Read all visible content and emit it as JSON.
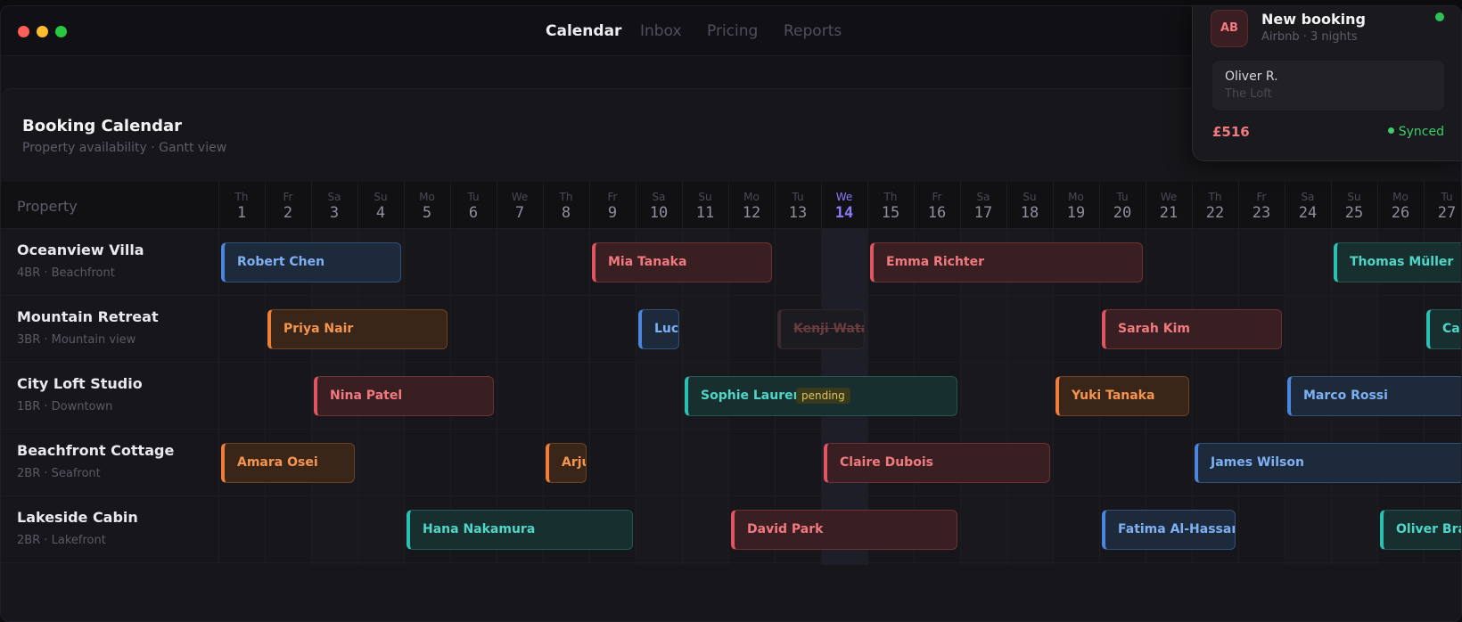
{
  "nav": {
    "tabs": [
      {
        "label": "Calendar",
        "active": true
      },
      {
        "label": "Inbox",
        "active": false
      },
      {
        "label": "Pricing",
        "active": false
      },
      {
        "label": "Reports",
        "active": false
      }
    ]
  },
  "window_controls": [
    "close",
    "minimize",
    "maximize"
  ],
  "colors": {
    "close": "#ff5f57",
    "minimize": "#febc2e",
    "maximize": "#28c840",
    "accent": "#8b7cf6"
  },
  "page": {
    "title": "Booking Calendar",
    "subtitle": "Property availability · Gantt view"
  },
  "grid": {
    "property_header": "Property",
    "days": [
      {
        "name": "Th",
        "num": "1"
      },
      {
        "name": "Fr",
        "num": "2"
      },
      {
        "name": "Sa",
        "num": "3"
      },
      {
        "name": "Su",
        "num": "4"
      },
      {
        "name": "Mo",
        "num": "5"
      },
      {
        "name": "Tu",
        "num": "6"
      },
      {
        "name": "We",
        "num": "7"
      },
      {
        "name": "Th",
        "num": "8"
      },
      {
        "name": "Fr",
        "num": "9"
      },
      {
        "name": "Sa",
        "num": "10"
      },
      {
        "name": "Su",
        "num": "11"
      },
      {
        "name": "Mo",
        "num": "12"
      },
      {
        "name": "Tu",
        "num": "13"
      },
      {
        "name": "We",
        "num": "14",
        "today": true
      },
      {
        "name": "Th",
        "num": "15"
      },
      {
        "name": "Fr",
        "num": "16"
      },
      {
        "name": "Sa",
        "num": "17"
      },
      {
        "name": "Su",
        "num": "18"
      },
      {
        "name": "Mo",
        "num": "19"
      },
      {
        "name": "Tu",
        "num": "20"
      },
      {
        "name": "We",
        "num": "21"
      },
      {
        "name": "Th",
        "num": "22"
      },
      {
        "name": "Fr",
        "num": "23"
      },
      {
        "name": "Sa",
        "num": "24"
      },
      {
        "name": "Su",
        "num": "25"
      },
      {
        "name": "Mo",
        "num": "26"
      },
      {
        "name": "Tu",
        "num": "27"
      }
    ],
    "properties": [
      {
        "name": "Oceanview Villa",
        "meta": "4BR · Beachfront",
        "bookings": [
          {
            "guest": "Robert Chen",
            "start": 1,
            "end": 5,
            "color": "blue"
          },
          {
            "guest": "Mia Tanaka",
            "start": 9,
            "end": 13,
            "color": "red"
          },
          {
            "guest": "Emma Richter",
            "start": 15,
            "end": 21,
            "color": "red"
          },
          {
            "guest": "Thomas Müller",
            "start": 25,
            "end": 28,
            "color": "teal"
          }
        ]
      },
      {
        "name": "Mountain Retreat",
        "meta": "3BR · Mountain view",
        "bookings": [
          {
            "guest": "Priya Nair",
            "start": 2,
            "end": 6,
            "color": "orange"
          },
          {
            "guest": "Lucas Ferr",
            "start": 10,
            "end": 11,
            "color": "blue"
          },
          {
            "guest": "Kenji Watanabe",
            "start": 13,
            "end": 15,
            "color": "ghost",
            "status": "cancelled"
          },
          {
            "guest": "Sarah Kim",
            "start": 20,
            "end": 24,
            "color": "red"
          },
          {
            "guest": "Ca",
            "start": 27,
            "end": 28,
            "color": "teal"
          }
        ]
      },
      {
        "name": "City Loft Studio",
        "meta": "1BR · Downtown",
        "bookings": [
          {
            "guest": "Nina Patel",
            "start": 3,
            "end": 7,
            "color": "red"
          },
          {
            "guest": "Sophie Laurent",
            "start": 11,
            "end": 17,
            "color": "teal",
            "badge": "pending"
          },
          {
            "guest": "Yuki Tanaka",
            "start": 19,
            "end": 22,
            "color": "orange"
          },
          {
            "guest": "Marco Rossi",
            "start": 24,
            "end": 28,
            "color": "blue"
          }
        ]
      },
      {
        "name": "Beachfront Cottage",
        "meta": "2BR · Seafront",
        "bookings": [
          {
            "guest": "Amara Osei",
            "start": 1,
            "end": 4,
            "color": "orange"
          },
          {
            "guest": "Arjun Shar",
            "start": 8,
            "end": 9,
            "color": "orange"
          },
          {
            "guest": "Claire Dubois",
            "start": 14,
            "end": 19,
            "color": "red"
          },
          {
            "guest": "James Wilson",
            "start": 22,
            "end": 28,
            "color": "blue"
          }
        ]
      },
      {
        "name": "Lakeside Cabin",
        "meta": "2BR · Lakefront",
        "bookings": [
          {
            "guest": "Hana Nakamura",
            "start": 5,
            "end": 10,
            "color": "teal"
          },
          {
            "guest": "David Park",
            "start": 12,
            "end": 17,
            "color": "red"
          },
          {
            "guest": "Fatima Al-Hassan",
            "start": 20,
            "end": 23,
            "color": "blue"
          },
          {
            "guest": "Oliver Bra",
            "start": 26,
            "end": 28,
            "color": "teal"
          }
        ]
      }
    ]
  },
  "notification": {
    "avatar": "AB",
    "title": "New booking",
    "subtitle": "Airbnb · 3 nights",
    "guest": "Oliver R.",
    "property": "The Loft",
    "price": "£516",
    "status": "Synced"
  }
}
